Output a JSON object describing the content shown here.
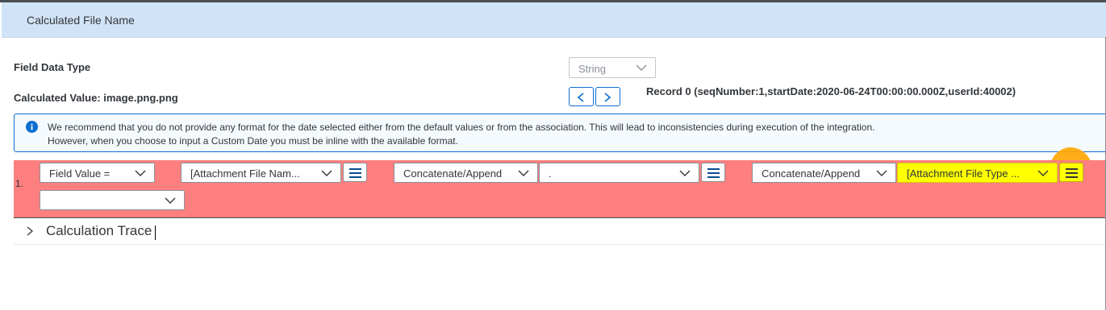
{
  "dialog": {
    "title": "Calculated File Name"
  },
  "field_data_type": {
    "label": "Field Data Type",
    "value": "String"
  },
  "calculated_value": {
    "label": "Calculated Value: image.png.png"
  },
  "record": {
    "text": "Record 0 (seqNumber:1,startDate:2020-06-24T00:00:00.000Z,userId:40002)"
  },
  "info": {
    "line1": "We recommend that you do not provide any format for the date selected either from the default values or from the association. This will lead to inconsistencies during execution of the integration.",
    "line2": "However, when you choose to input a Custom Date you must be inline with the available format."
  },
  "formula": {
    "row_number": "1.",
    "field_value_op": "Field Value =",
    "operand1": "[Attachment File Nam...",
    "op1": "Concatenate/Append",
    "operand2": ".",
    "op2": "Concatenate/Append",
    "operand3": "[Attachment File Type ...",
    "extra_select": ""
  },
  "trace": {
    "label": "Calculation Trace"
  },
  "colors": {
    "header_bg": "#d1e3f6",
    "accent": "#0a6ed1",
    "row_highlight": "#fe7f7f",
    "yellow_highlight": "#ffff00",
    "orange_annotation": "#ffa500"
  }
}
